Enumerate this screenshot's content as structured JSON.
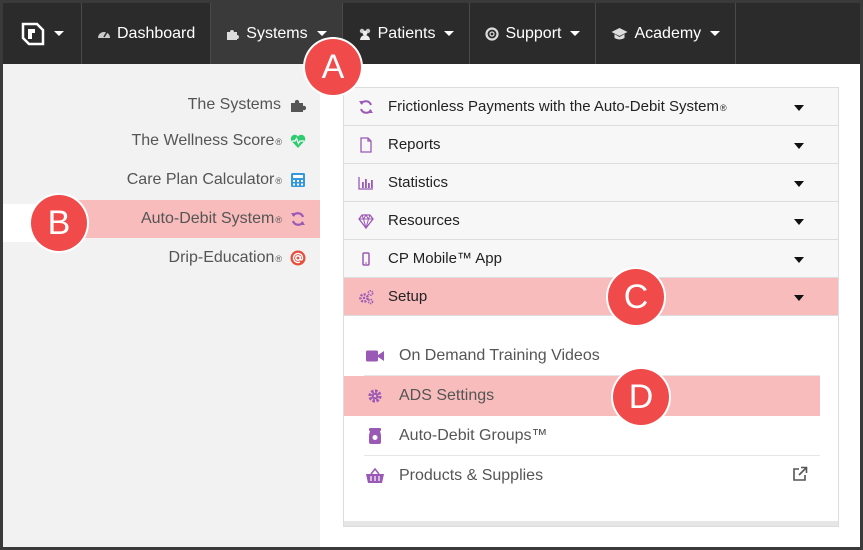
{
  "nav": {
    "items": [
      {
        "label": "Dashboard",
        "icon": "dashboard-icon"
      },
      {
        "label": "Systems",
        "icon": "puzzle-icon"
      },
      {
        "label": "Patients",
        "icon": "users-icon"
      },
      {
        "label": "Support",
        "icon": "lifebuoy-icon"
      },
      {
        "label": "Academy",
        "icon": "graduation-cap-icon"
      }
    ]
  },
  "sidebar": {
    "items": [
      {
        "label": "The Systems",
        "reg": "",
        "icon": "puzzle-icon"
      },
      {
        "label": "The Wellness Score",
        "reg": "®",
        "icon": "heart-icon"
      },
      {
        "label": "Care Plan Calculator",
        "reg": "®",
        "icon": "calculator-icon"
      },
      {
        "label": "Auto-Debit System",
        "reg": "®",
        "icon": "refresh-icon"
      },
      {
        "label": "Drip-Education",
        "reg": "®",
        "icon": "at-sign-icon"
      }
    ]
  },
  "accordion": {
    "sections": [
      {
        "label": "Frictionless Payments with the Auto-Debit System",
        "reg": "®",
        "icon": "refresh-icon"
      },
      {
        "label": "Reports",
        "reg": "",
        "icon": "file-icon"
      },
      {
        "label": "Statistics",
        "reg": "",
        "icon": "bar-chart-icon"
      },
      {
        "label": "Resources",
        "reg": "",
        "icon": "diamond-icon"
      },
      {
        "label": "CP Mobile™ App",
        "reg": "",
        "icon": "mobile-icon"
      },
      {
        "label": "Setup",
        "reg": "",
        "icon": "gears-icon"
      }
    ],
    "setup_items": [
      {
        "label": "On Demand Training Videos",
        "icon": "video-camera-icon"
      },
      {
        "label": "ADS Settings",
        "icon": "gear-icon"
      },
      {
        "label": "Auto-Debit Groups™",
        "icon": "jar-icon"
      },
      {
        "label": "Products & Supplies",
        "icon": "basket-icon"
      }
    ]
  },
  "callouts": {
    "a": "A",
    "b": "B",
    "c": "C",
    "d": "D"
  },
  "colors": {
    "nav_bg": "#2b2b2b",
    "highlight": "#f8bcbc",
    "callout": "#f04a4a",
    "icon_purple": "#9b59b6",
    "icon_red": "#e74c3c",
    "icon_green": "#2ecc71",
    "icon_blue": "#3498db"
  }
}
